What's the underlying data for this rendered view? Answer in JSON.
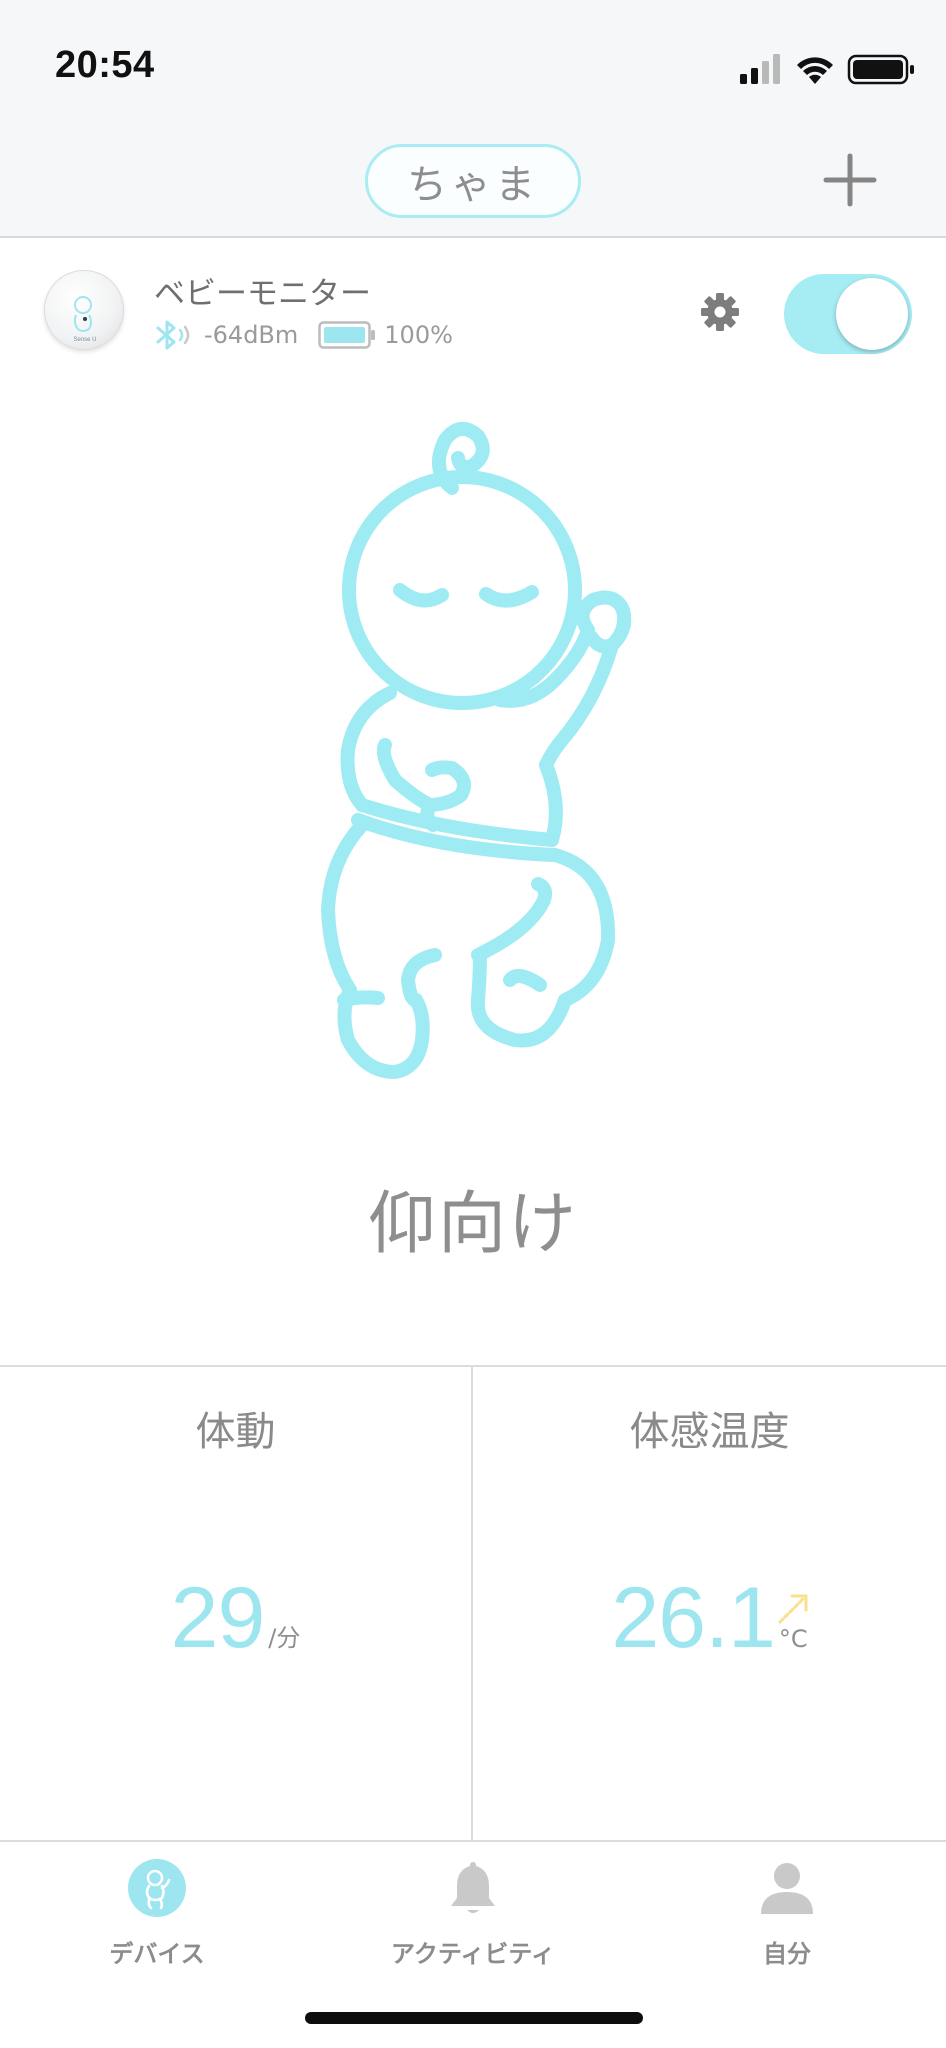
{
  "status_bar": {
    "time": "20:54"
  },
  "nav": {
    "profile_name": "ちゃま"
  },
  "device": {
    "name": "ベビーモニター",
    "signal": "-64dBm",
    "battery": "100%",
    "battery_level": 1.0,
    "monitoring_enabled": true
  },
  "posture": {
    "label": "仰向け"
  },
  "metrics": {
    "movement": {
      "title": "体動",
      "value": "29",
      "unit": "/分"
    },
    "temperature": {
      "title": "体感温度",
      "value": "26.1",
      "unit": "°C",
      "trend": "rising"
    }
  },
  "tabs": [
    {
      "label": "デバイス",
      "icon": "baby-icon",
      "active": true
    },
    {
      "label": "アクティビティ",
      "icon": "bell-icon",
      "active": false
    },
    {
      "label": "自分",
      "icon": "person-icon",
      "active": false
    }
  ],
  "colors": {
    "accent": "#9ee6ef",
    "text": "#8c8c8c",
    "toggle_on": "#a6ecf3"
  }
}
